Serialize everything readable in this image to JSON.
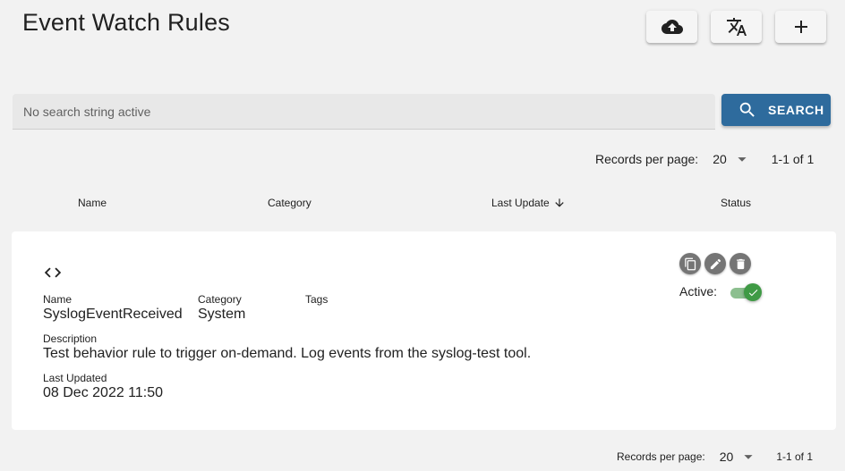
{
  "header": {
    "title": "Event Watch Rules",
    "buttons": [
      {
        "icon": "cloud-upload-icon"
      },
      {
        "icon": "translate-icon"
      },
      {
        "icon": "plus-icon"
      }
    ]
  },
  "search": {
    "placeholder": "No search string active",
    "button_label": "SEARCH",
    "button_color": "#2e6b9d"
  },
  "pagination_top": {
    "records_per_page_label": "Records per page:",
    "records_per_page_value": "20",
    "range": "1-1 of 1"
  },
  "table": {
    "columns": [
      "Name",
      "Category",
      "Last Update",
      "Status"
    ],
    "sort_column": "Last Update",
    "sort_direction": "descending"
  },
  "rule": {
    "name_label": "Name",
    "name": "SyslogEventReceived",
    "category_label": "Category",
    "category": "System",
    "tags_label": "Tags",
    "tags": "",
    "description_label": "Description",
    "description": "Test behavior rule to trigger on-demand. Log events from the syslog-test tool.",
    "last_updated_label": "Last Updated",
    "last_updated": "08 Dec 2022 11:50",
    "active_label": "Active:",
    "active": true,
    "active_color": "#3f9a45"
  },
  "pagination_bottom": {
    "records_per_page_label": "Records per page:",
    "records_per_page_value": "20",
    "range": "1-1 of 1"
  }
}
